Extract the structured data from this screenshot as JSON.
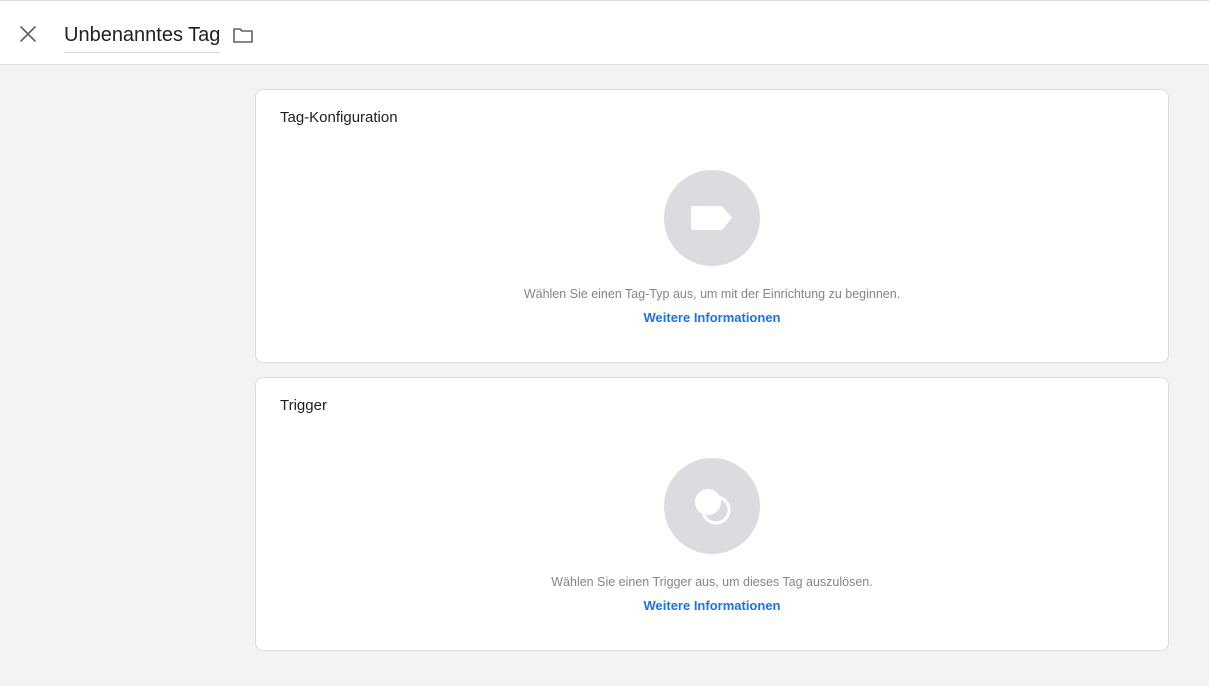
{
  "header": {
    "title": "Unbenanntes Tag",
    "close_icon": "close-icon",
    "folder_icon": "folder-icon"
  },
  "tag_config": {
    "title": "Tag-Konfiguration",
    "icon": "tag-icon",
    "hint": "Wählen Sie einen Tag-Typ aus, um mit der Einrichtung zu beginnen.",
    "link": "Weitere Informationen"
  },
  "trigger": {
    "title": "Trigger",
    "icon": "trigger-icon",
    "hint": "Wählen Sie einen Trigger aus, um dieses Tag auszulösen.",
    "link": "Weitere Informationen"
  },
  "colors": {
    "background": "#f1f3f4",
    "card": "#ffffff",
    "circle": "#dadce0",
    "link": "#1a73e8",
    "hint": "#80868b",
    "text": "#202124"
  }
}
